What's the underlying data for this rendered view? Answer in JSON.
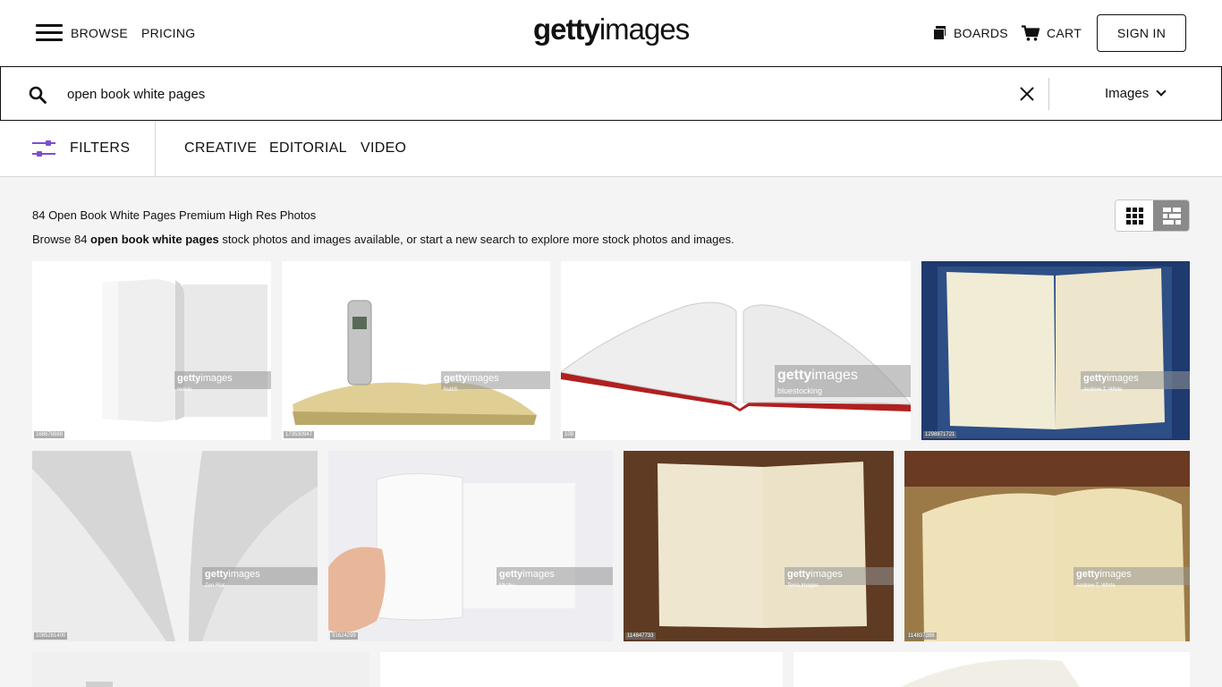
{
  "header": {
    "browse_label": "BROWSE",
    "pricing_label": "PRICING",
    "logo_bold": "getty",
    "logo_light": "images",
    "boards_label": "BOARDS",
    "cart_label": "CART",
    "signin_label": "SIGN IN"
  },
  "search": {
    "query": "open book white pages",
    "type_label": "Images"
  },
  "filters": {
    "label": "FILTERS",
    "tabs": [
      "CREATIVE",
      "EDITORIAL",
      "VIDEO"
    ]
  },
  "results": {
    "title": "84 Open Book White Pages Premium High Res Photos",
    "desc_prefix": "Browse 84 ",
    "desc_query": "open book white pages",
    "desc_suffix": " stock photos and images available, or start a new search to explore more stock photos and images."
  },
  "watermark": {
    "brand": "getty",
    "brand_rest": "images"
  },
  "images": [
    {
      "credit": "redslo",
      "id": "168678888"
    },
    {
      "credit": "fruttiS",
      "id": "173530947"
    },
    {
      "credit": "bluestocking",
      "id": "108"
    },
    {
      "credit": "Andrew T. White",
      "id": "1298871721"
    },
    {
      "credit": "Zen Rial",
      "id": "1085281400"
    },
    {
      "credit": "Mkzhu",
      "id": "91624299"
    },
    {
      "credit": "Terra Images",
      "id": "114847733"
    },
    {
      "credit": "Andrew T. White",
      "id": "114837288"
    }
  ],
  "colors": {
    "accent": "#7b4fd0",
    "text": "#111111",
    "page_bg": "#f4f4f4"
  }
}
